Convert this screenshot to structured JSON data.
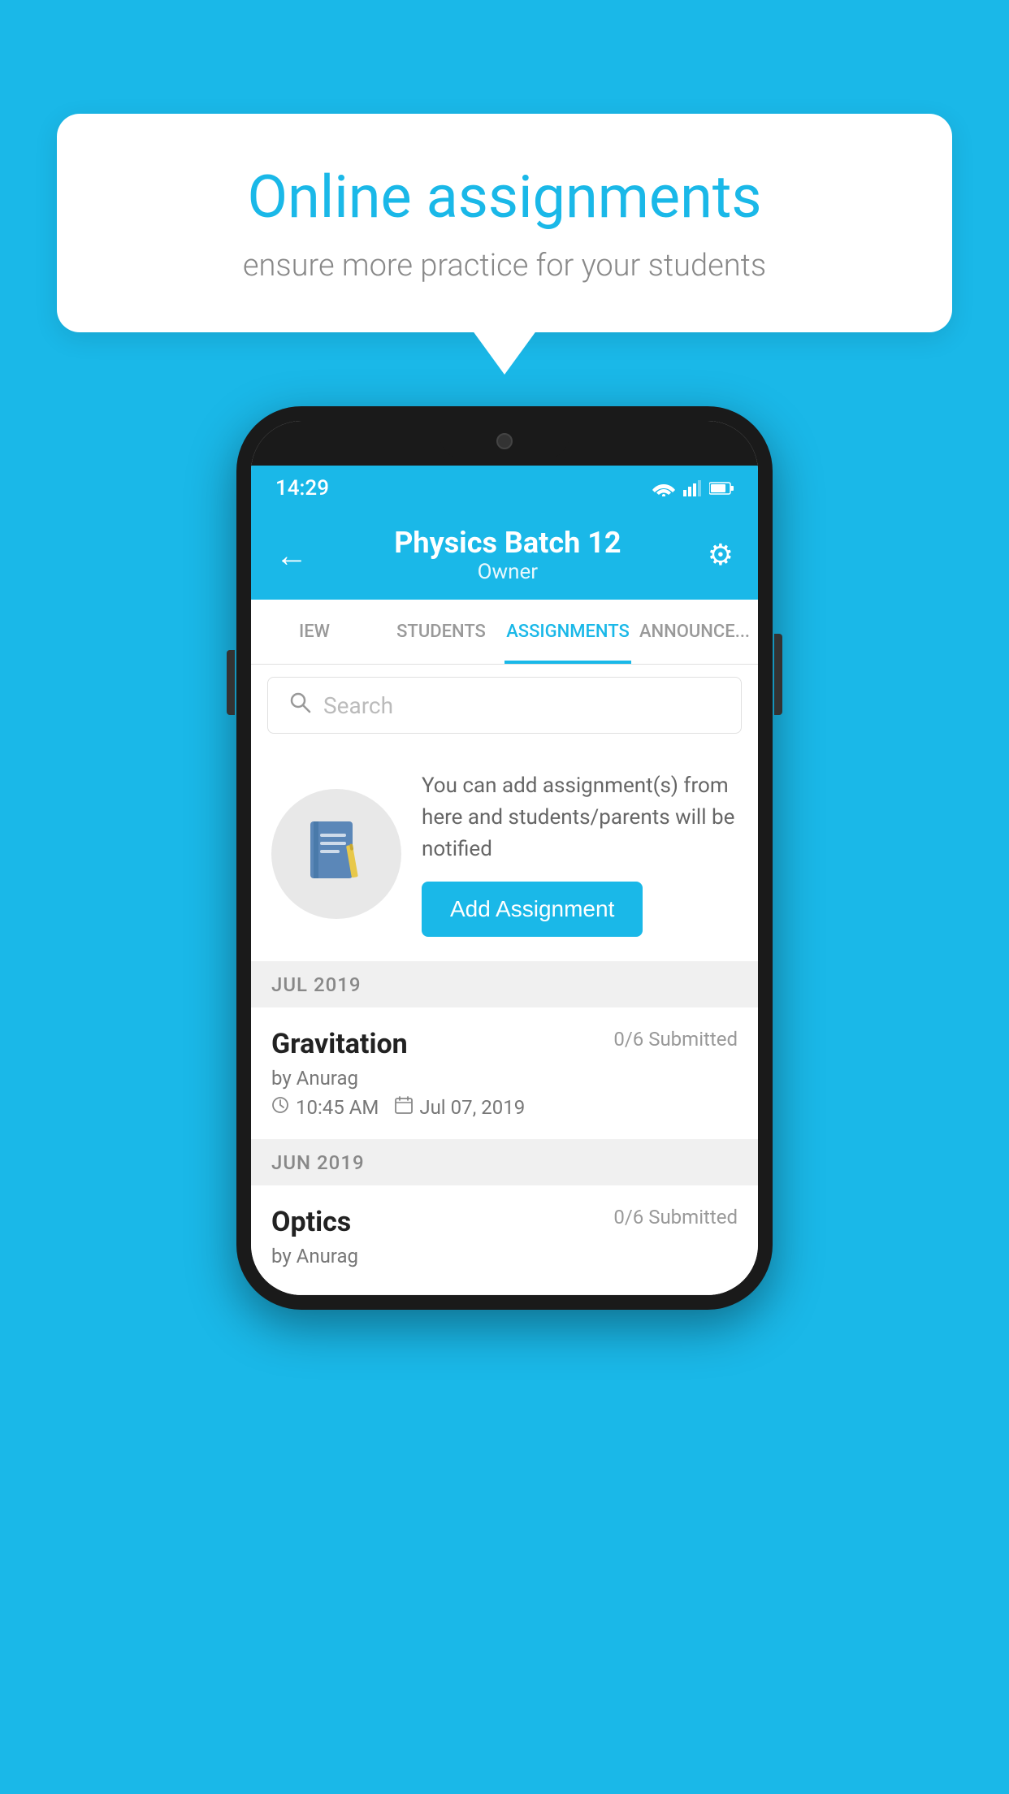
{
  "background_color": "#1ab8e8",
  "speech_bubble": {
    "title": "Online assignments",
    "subtitle": "ensure more practice for your students"
  },
  "status_bar": {
    "time": "14:29",
    "wifi": "▾",
    "signal": "▲",
    "battery": "▮"
  },
  "app_bar": {
    "title": "Physics Batch 12",
    "subtitle": "Owner",
    "back_label": "←",
    "settings_label": "⚙"
  },
  "tabs": [
    {
      "id": "overview",
      "label": "IEW",
      "active": false
    },
    {
      "id": "students",
      "label": "STUDENTS",
      "active": false
    },
    {
      "id": "assignments",
      "label": "ASSIGNMENTS",
      "active": true
    },
    {
      "id": "announcements",
      "label": "ANNOUNCE...",
      "active": false
    }
  ],
  "search": {
    "placeholder": "Search"
  },
  "promo": {
    "text": "You can add assignment(s) from here and students/parents will be notified",
    "button_label": "Add Assignment"
  },
  "sections": [
    {
      "month": "JUL 2019",
      "assignments": [
        {
          "title": "Gravitation",
          "submitted": "0/6 Submitted",
          "by": "by Anurag",
          "time": "10:45 AM",
          "date": "Jul 07, 2019"
        }
      ]
    },
    {
      "month": "JUN 2019",
      "assignments": [
        {
          "title": "Optics",
          "submitted": "0/6 Submitted",
          "by": "by Anurag",
          "time": "",
          "date": ""
        }
      ]
    }
  ]
}
